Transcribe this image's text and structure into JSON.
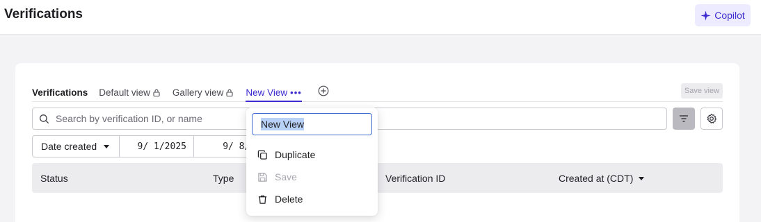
{
  "header": {
    "title": "Verifications",
    "copilot_label": "Copilot"
  },
  "tabs": {
    "section_label": "Verifications",
    "items": [
      {
        "label": "Default view",
        "locked": true
      },
      {
        "label": "Gallery view",
        "locked": true
      },
      {
        "label": "New View",
        "active": true,
        "more": "•••"
      }
    ],
    "save_view_label": "Save view"
  },
  "search": {
    "placeholder": "Search by verification ID, or name",
    "value": ""
  },
  "date_filter": {
    "selected": "Date created",
    "start": "9/ 1/2025",
    "end": "9/ 8/20"
  },
  "table": {
    "columns": [
      "Status",
      "Type",
      "Verification ID",
      "Created at (CDT)"
    ]
  },
  "view_menu": {
    "name_value": "New View",
    "items": [
      {
        "label": "Duplicate",
        "icon": "copy-icon",
        "disabled": false
      },
      {
        "label": "Save",
        "icon": "save-icon",
        "disabled": true
      },
      {
        "label": "Delete",
        "icon": "trash-icon",
        "disabled": false
      }
    ]
  },
  "colors": {
    "accent": "#3d2ccf",
    "copilot_bg": "#ecebff",
    "selection": "#b7d1f7"
  }
}
